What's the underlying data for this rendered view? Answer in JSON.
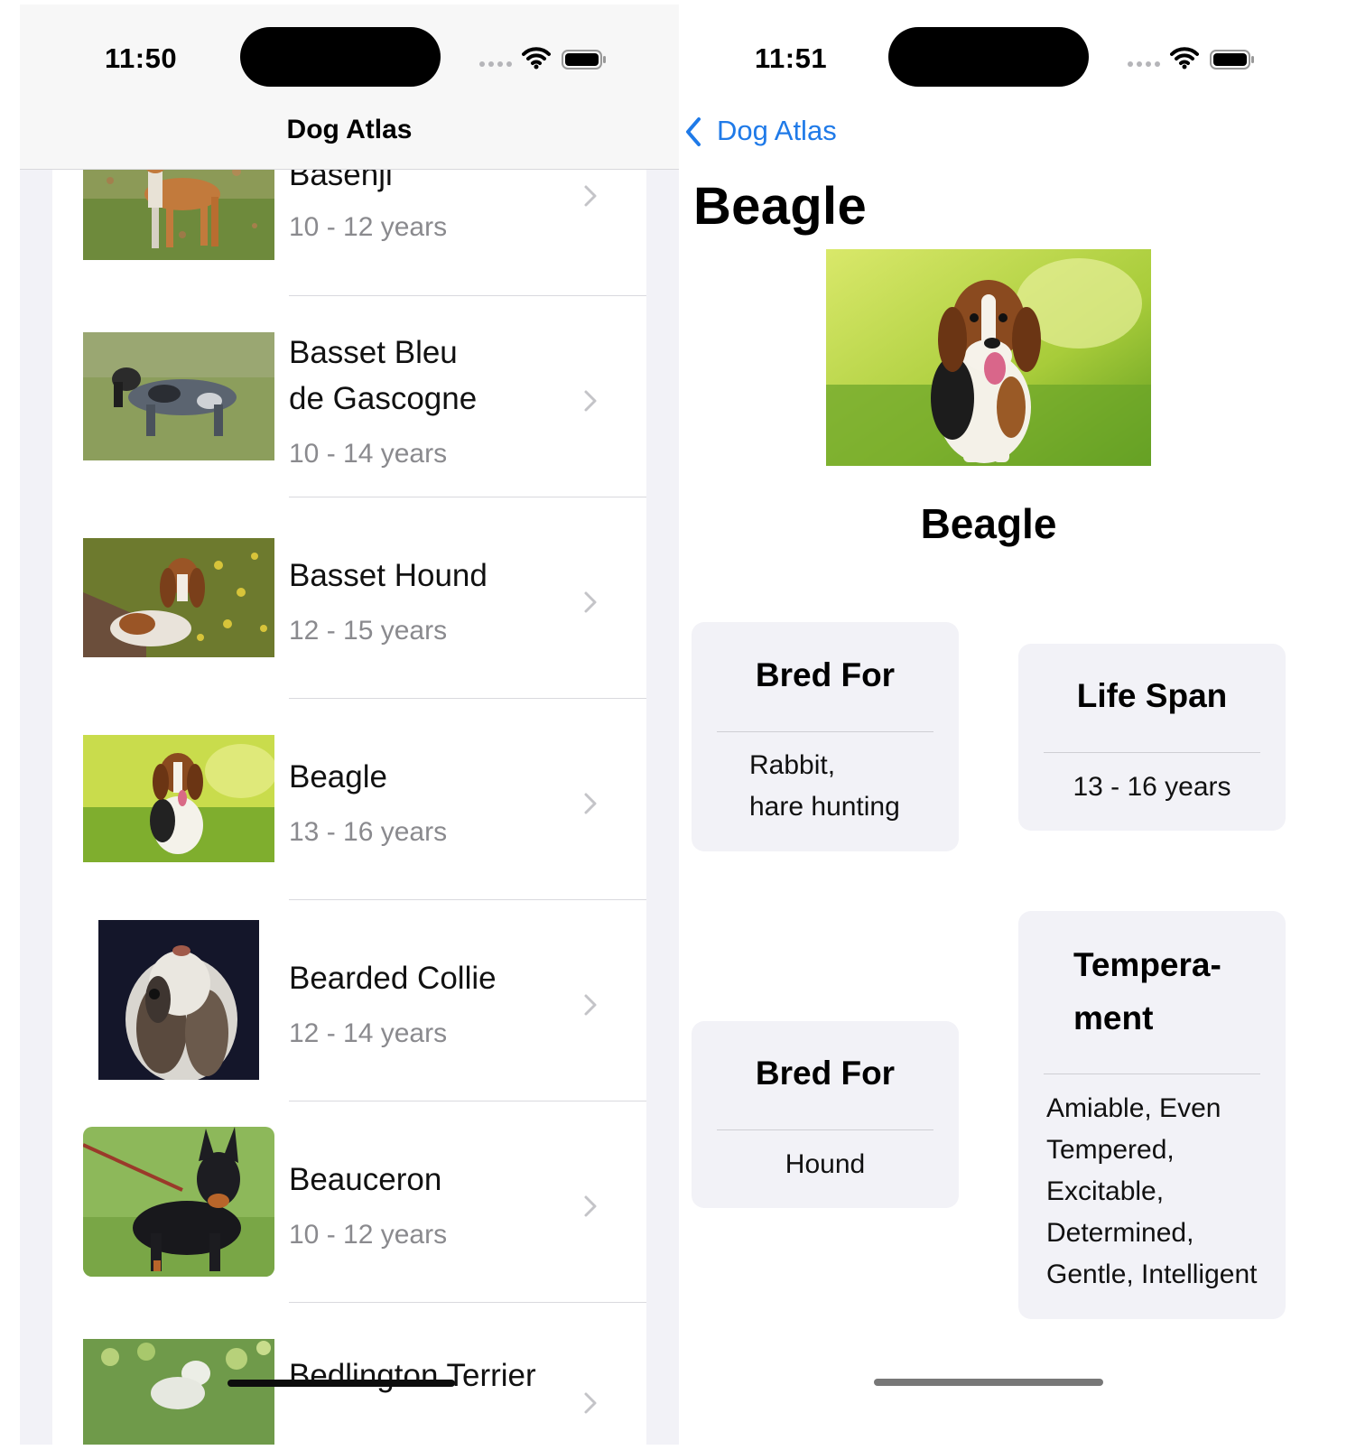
{
  "left_screen": {
    "status": {
      "time": "11:50"
    },
    "nav_title": "Dog Atlas",
    "breeds": [
      {
        "name": "Basenji",
        "life_span": "10 - 12 years"
      },
      {
        "name": "Basset Bleu",
        "name_line2": "de Gascogne",
        "life_span": "10 - 14 years"
      },
      {
        "name": "Basset Hound",
        "life_span": "12 - 15 years"
      },
      {
        "name": "Beagle",
        "life_span": "13 - 16 years"
      },
      {
        "name": "Bearded Collie",
        "life_span": "12 - 14 years"
      },
      {
        "name": "Beauceron",
        "life_span": "10 - 12 years"
      },
      {
        "name": "Bedlington Terrier"
      }
    ]
  },
  "right_screen": {
    "status": {
      "time": "11:51"
    },
    "back_label": "Dog Atlas",
    "large_title": "Beagle",
    "hero_name": "Beagle",
    "cards": {
      "bred_for": {
        "title": "Bred For",
        "line1": "Rabbit,",
        "line2": "hare hunting"
      },
      "life_span": {
        "title": "Life Span",
        "value": "13 - 16 years"
      },
      "breed_group": {
        "title": "Bred For",
        "value": "Hound"
      },
      "temperament": {
        "title_line1": "Tempera-",
        "title_line2": "ment",
        "lines": [
          "Amiable, Even",
          "Tempered,",
          "Excitable,",
          "Determined,",
          "Gentle, Intelligent"
        ]
      }
    }
  },
  "colors": {
    "accent_blue": "#1f7ae8",
    "secondary_gray": "#8a8a8e",
    "card_background": "#f2f2f7"
  }
}
